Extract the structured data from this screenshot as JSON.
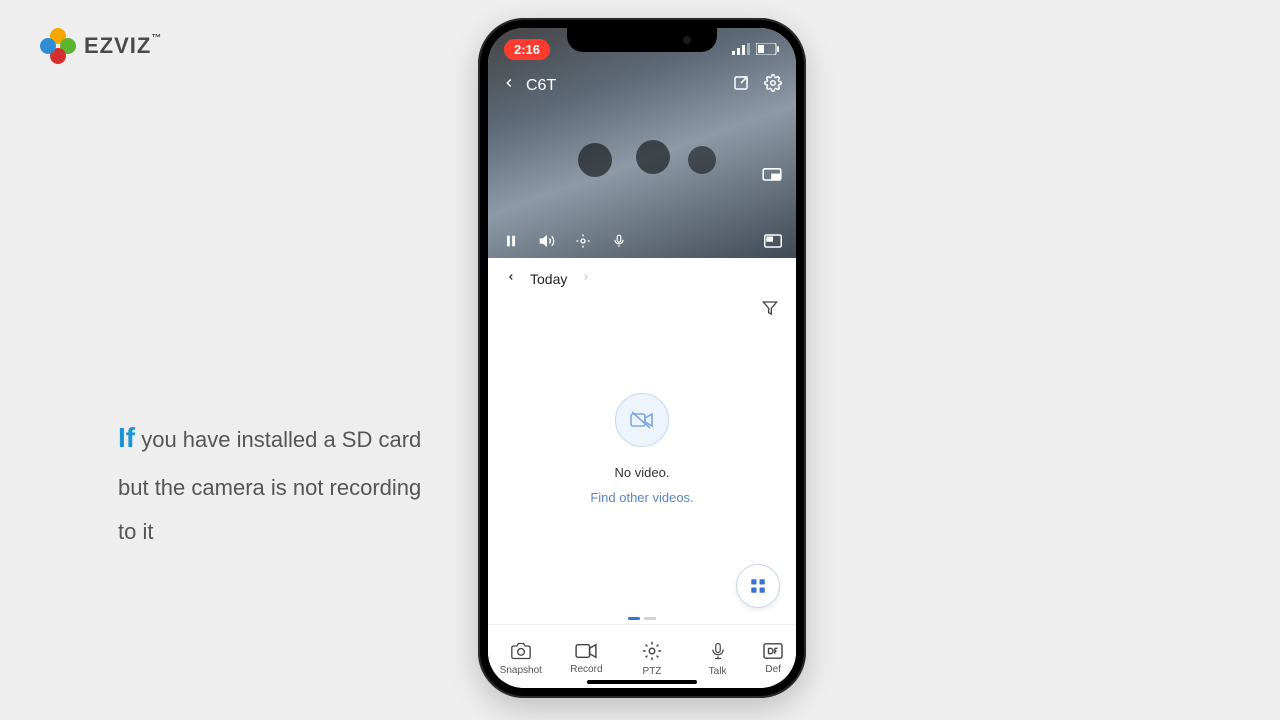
{
  "logo": {
    "text": "EZVIZ"
  },
  "caption": {
    "lead": "If",
    "rest": " you have installed a SD card but the camera is not recording to it"
  },
  "statusbar": {
    "time": "2:16"
  },
  "topbar": {
    "device": "C6T"
  },
  "date": {
    "label": "Today"
  },
  "empty": {
    "title": "No video.",
    "link": "Find other videos."
  },
  "tabs": {
    "snapshot": "Snapshot",
    "record": "Record",
    "ptz": "PTZ",
    "talk": "Talk",
    "def": "Def"
  }
}
